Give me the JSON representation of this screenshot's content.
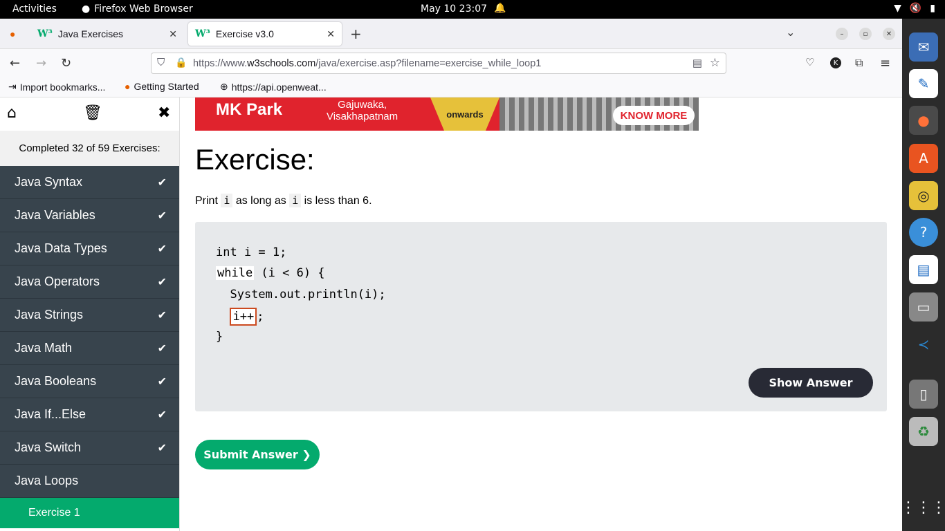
{
  "topbar": {
    "activities": "Activities",
    "app_name": "Firefox Web Browser",
    "clock": "May 10  23:07"
  },
  "browser": {
    "tabs": [
      {
        "label": "Java Exercises"
      },
      {
        "label": "Exercise v3.0"
      }
    ],
    "url_prefix": "https://www.",
    "url_domain": "w3schools.com",
    "url_path": "/java/exercise.asp?filename=exercise_while_loop1",
    "bookmarks": [
      {
        "label": "Import bookmarks..."
      },
      {
        "label": "Getting Started"
      },
      {
        "label": "https://api.openweat..."
      }
    ]
  },
  "sidebar": {
    "progress": "Completed 32 of 59 Exercises:",
    "topics": [
      {
        "label": "Java Syntax",
        "done": true
      },
      {
        "label": "Java Variables",
        "done": true
      },
      {
        "label": "Java Data Types",
        "done": true
      },
      {
        "label": "Java Operators",
        "done": true
      },
      {
        "label": "Java Strings",
        "done": true
      },
      {
        "label": "Java Math",
        "done": true
      },
      {
        "label": "Java Booleans",
        "done": true
      },
      {
        "label": "Java If...Else",
        "done": true
      },
      {
        "label": "Java Switch",
        "done": true
      },
      {
        "label": "Java Loops",
        "done": false
      }
    ],
    "current_exercise": "Exercise 1"
  },
  "ad": {
    "brand": "MK Park",
    "location_line1": "Gajuwaka,",
    "location_line2": "Visakhapatnam",
    "onwards": "onwards",
    "cta": "KNOW MORE"
  },
  "exercise": {
    "title": "Exercise:",
    "desc_1": "Print ",
    "desc_var1": "i",
    "desc_2": " as long as ",
    "desc_var2": "i",
    "desc_3": " is less than 6.",
    "code_line1": "int i = 1;",
    "code_kw": "while",
    "code_line2_rest": " (i < 6) {",
    "code_line3": "  System.out.println(i);",
    "code_answer": "i++",
    "code_line4_rest": ";",
    "code_line5": "}",
    "show_answer": "Show Answer",
    "submit": "Submit Answer ❯"
  },
  "colors": {
    "accent_green": "#04aa6d",
    "sidebar_dark": "#38444d",
    "button_dark": "#282a35",
    "answer_border": "#cc4a1f"
  }
}
